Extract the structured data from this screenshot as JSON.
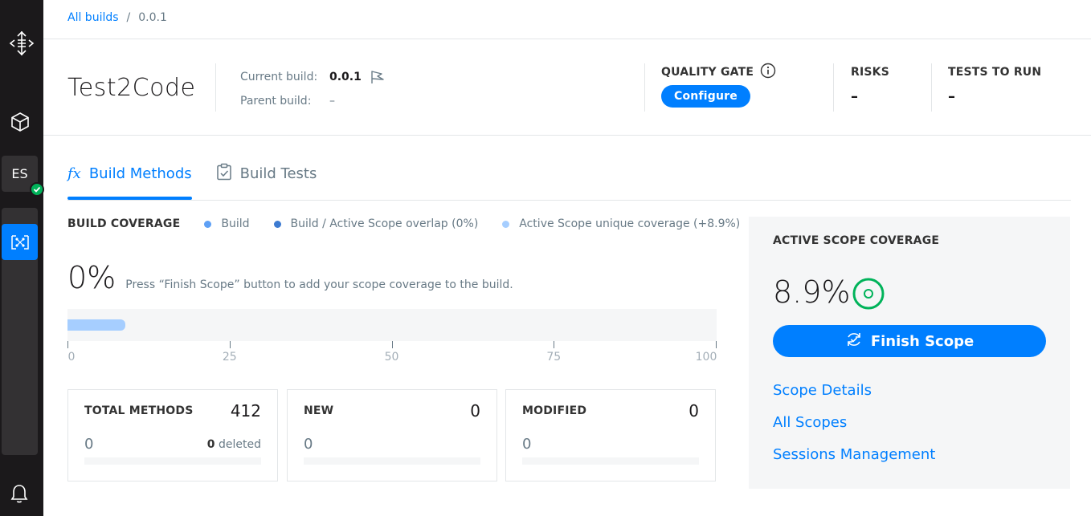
{
  "sidebar": {
    "logo_icon": "drill-logo-icon",
    "agent_badge": "ES",
    "status_icon": "check-icon",
    "colors": {
      "bg": "#1b191b",
      "active": "#007fff",
      "status_ok": "#00b35a"
    }
  },
  "breadcrumb": {
    "root": "All builds",
    "separator": "/",
    "current": "0.0.1"
  },
  "header": {
    "plugin_title": "Test2Code",
    "current_build_label": "Current build:",
    "current_build_value": "0.0.1",
    "parent_build_label": "Parent build:",
    "parent_build_value": "–",
    "quality_gate_label": "QUALITY GATE",
    "configure_label": "Configure",
    "risks_label": "RISKS",
    "risks_value": "–",
    "tests_to_run_label": "TESTS TO RUN",
    "tests_to_run_value": "–"
  },
  "tabs": [
    {
      "label": "Build Methods",
      "icon": "fx-icon",
      "active": true
    },
    {
      "label": "Build Tests",
      "icon": "clipboard-icon",
      "active": false
    }
  ],
  "coverage": {
    "title": "BUILD COVERAGE",
    "legend": [
      {
        "label": "Build",
        "color": "#5ea0f5"
      },
      {
        "label": "Build / Active Scope overlap (0%)",
        "color": "#3d7bd1"
      },
      {
        "label": "Active Scope unique coverage (+8.9%)",
        "color": "#a6ceff"
      }
    ],
    "percent": "0%",
    "hint": "Press “Finish Scope” button to add your scope coverage to the build.",
    "active_scope_fill": 8.9,
    "axis_ticks": [
      "0",
      "25",
      "50",
      "75",
      "100"
    ]
  },
  "cards": [
    {
      "title": "TOTAL METHODS",
      "total": "412",
      "count": "0",
      "deleted_count": "0",
      "deleted_label": "deleted"
    },
    {
      "title": "NEW",
      "total": "0",
      "count": "0"
    },
    {
      "title": "MODIFIED",
      "total": "0",
      "count": "0"
    }
  ],
  "active_scope": {
    "title": "ACTIVE SCOPE COVERAGE",
    "percent": "8.9%",
    "finish_label": "Finish Scope",
    "links": [
      "Scope Details",
      "All Scopes",
      "Sessions Management"
    ],
    "ring_color": "#00b35a"
  }
}
